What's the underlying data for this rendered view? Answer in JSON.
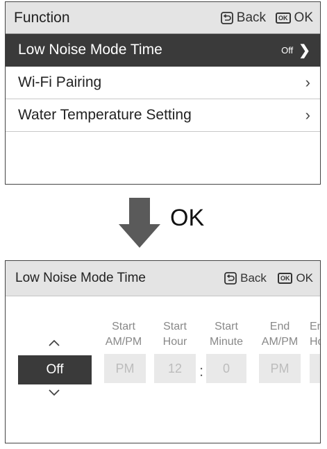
{
  "screen1": {
    "title": "Function",
    "back_label": "Back",
    "ok_icon_text": "OK",
    "ok_label": "OK",
    "items": [
      {
        "label": "Low Noise Mode Time",
        "value": "Off",
        "selected": true
      },
      {
        "label": "Wi-Fi Pairing",
        "value": "",
        "selected": false
      },
      {
        "label": "Water Temperature Setting",
        "value": "",
        "selected": false
      }
    ]
  },
  "transition": {
    "label": "OK"
  },
  "screen2": {
    "title": "Low Noise Mode Time",
    "back_label": "Back",
    "ok_icon_text": "OK",
    "ok_label": "OK",
    "selector_value": "Off",
    "columns": [
      {
        "head1": "Start",
        "head2": "AM/PM",
        "value": "PM"
      },
      {
        "head1": "Start",
        "head2": "Hour",
        "value": "12"
      },
      {
        "head1": "Start",
        "head2": "Minute",
        "value": "0"
      },
      {
        "head1": "End",
        "head2": "AM/PM",
        "value": "PM"
      },
      {
        "head1": "End",
        "head2": "Hour",
        "value": ""
      }
    ],
    "separator": ":"
  },
  "colors": {
    "header_bg": "#e4e4e4",
    "selected_bg": "#3a3a3a",
    "disabled_text": "#bcbcbc",
    "arrow": "#5a5a5a"
  },
  "icons": [
    "back-icon",
    "ok-icon",
    "chevron-right-icon",
    "chevron-up-icon",
    "chevron-down-icon",
    "down-arrow-icon"
  ]
}
